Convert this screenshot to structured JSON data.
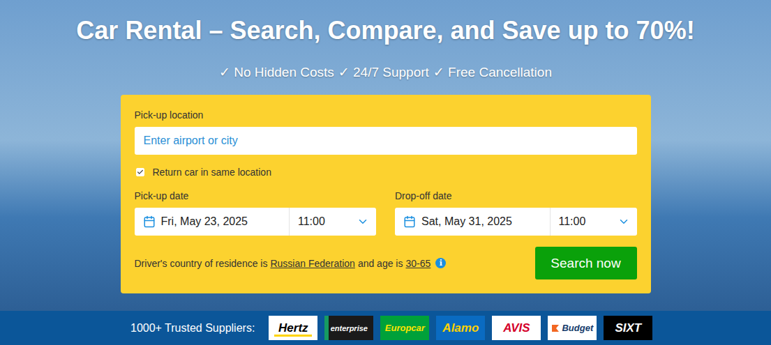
{
  "header": {
    "title": "Car Rental – Search, Compare, and Save up to 70%!",
    "features": [
      {
        "mark": "✓",
        "label": "No Hidden Costs"
      },
      {
        "mark": "✓",
        "label": "24/7 Support"
      },
      {
        "mark": "✓",
        "label": "Free Cancellation"
      }
    ]
  },
  "form": {
    "pickup_label": "Pick-up location",
    "pickup_placeholder": "Enter airport or city",
    "same_location": {
      "label": "Return car in same location",
      "checked": true
    },
    "dates": [
      {
        "label": "Pick-up date",
        "date": "Fri, May 23, 2025",
        "time": "11:00"
      },
      {
        "label": "Drop-off date",
        "date": "Sat, May 31, 2025",
        "time": "11:00"
      }
    ],
    "residence": {
      "prefix": "Driver's country of residence is",
      "country": "Russian Federation",
      "middle": "and age is",
      "age": "30-65",
      "info": "i"
    },
    "button": "Search now"
  },
  "suppliers": {
    "label": "1000+ Trusted Suppliers:",
    "items": [
      {
        "name": "Hertz",
        "color": "#ffffff",
        "text_color": "#000000",
        "accent": "#ffd400"
      },
      {
        "name": "enterprise",
        "color": "#1a1a1a",
        "text_color": "#ffffff",
        "accent": "#169b62"
      },
      {
        "name": "Europcar",
        "color": "#00a13a",
        "text_color": "#ffe500"
      },
      {
        "name": "Alamo",
        "color": "#0a6bc1",
        "text_color": "#ffd200"
      },
      {
        "name": "AVIS",
        "color": "#ffffff",
        "text_color": "#d4002a"
      },
      {
        "name": "Budget",
        "color": "#ffffff",
        "text_color": "#143b6b",
        "accent": "#f26722"
      },
      {
        "name": "SIXT",
        "color": "#000000",
        "text_color": "#ffffff"
      }
    ]
  }
}
